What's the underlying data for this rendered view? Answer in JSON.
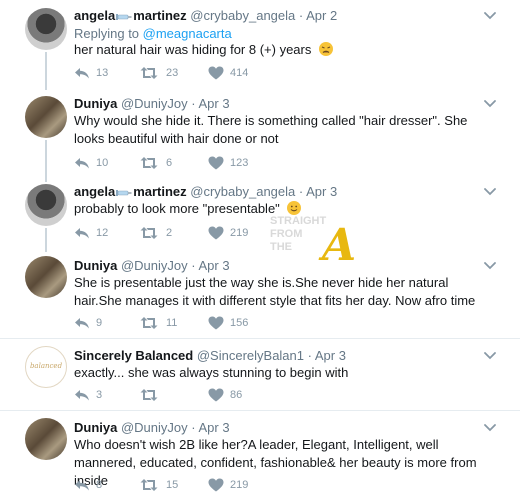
{
  "tweets": [
    {
      "name": "angela",
      "name2": "martinez",
      "handle": "@crybaby_angela",
      "date": "· Apr 2",
      "reply_prefix": "Replying to ",
      "reply_to": "@meagnacarta",
      "text": "her natural hair was hiding for 8 (+) years",
      "replies": "13",
      "retweets": "23",
      "likes": "414"
    },
    {
      "name": "Duniya",
      "handle": "@DuniyJoy",
      "date": "· Apr 3",
      "text": "Why would she hide it.  There is something called \"hair dresser\".  She looks beautiful with hair done or not",
      "replies": "10",
      "retweets": "6",
      "likes": "123"
    },
    {
      "name": "angela",
      "name2": "martinez",
      "handle": "@crybaby_angela",
      "date": "· Apr 3",
      "text": "probably to look more \"presentable\"",
      "replies": "12",
      "retweets": "2",
      "likes": "219"
    },
    {
      "name": "Duniya",
      "handle": "@DuniyJoy",
      "date": "· Apr 3",
      "text": "She is presentable just the way she is.She never hide her natural hair.She manages it with different style that fits her day. Now afro time",
      "replies": "9",
      "retweets": "11",
      "likes": "156"
    },
    {
      "name": "Sincerely Balanced",
      "handle": "@SincerelyBalan1",
      "date": "· Apr 3",
      "avatar_text": "balanced",
      "text": "exactly... she was always stunning to begin with",
      "replies": "3",
      "retweets": "",
      "likes": "86"
    },
    {
      "name": "Duniya",
      "handle": "@DuniyJoy",
      "date": "· Apr 3",
      "text": "Who doesn't wish 2B like her?A leader, Elegant, Intelligent, well mannered, educated, confident, fashionable& her beauty is more from inside",
      "replies": "8",
      "retweets": "15",
      "likes": "219"
    }
  ],
  "watermark": {
    "line1": "STRAIGHT",
    "line2": "FROM",
    "line3": "THE",
    "letter": "A"
  },
  "colors": {
    "link": "#1da1f2",
    "muted": "#657786",
    "icon": "#8899a6",
    "connector": "#ccd6dd"
  },
  "icons": [
    "reply-icon",
    "retweet-icon",
    "heart-icon",
    "chevron-down-icon",
    "weary-face-emoji",
    "slightly-smiling-face-emoji",
    "syringe-emoji"
  ]
}
